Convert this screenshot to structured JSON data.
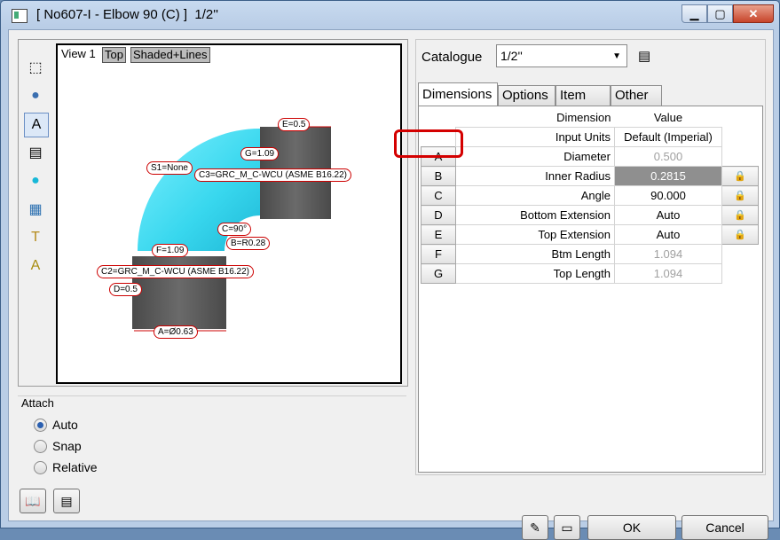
{
  "window": {
    "title": "[ No607-I - Elbow 90 (C) ]  1/2''"
  },
  "viewport": {
    "view_label": "View 1",
    "view_buttons": [
      "Top",
      "Shaded+Lines"
    ],
    "dimension_labels": {
      "e": "E=0.5",
      "g": "G=1.09",
      "s1": "S1=None",
      "c3": "C3=GRC_M_C-WCU (ASME B16.22)",
      "c": "C=90°",
      "b": "B=R0.28",
      "f": "F=1.09",
      "c2": "C2=GRC_M_C-WCU (ASME B16.22)",
      "d": "D=0.5",
      "a": "A=Ø0.63"
    }
  },
  "attach": {
    "title": "Attach",
    "options": [
      {
        "label": "Auto",
        "selected": true
      },
      {
        "label": "Snap",
        "selected": false
      },
      {
        "label": "Relative",
        "selected": false
      }
    ]
  },
  "catalogue": {
    "label": "Catalogue",
    "value": "1/2''"
  },
  "tabs": [
    "Dimensions",
    "Options",
    "Item",
    "Other"
  ],
  "table": {
    "headers": {
      "dimension": "Dimension",
      "value": "Value"
    },
    "units": {
      "label": "Input Units",
      "value": "Default (Imperial)"
    },
    "rows": [
      {
        "key": "A",
        "name": "Diameter",
        "value": "0.500",
        "state": "grey",
        "lock": false
      },
      {
        "key": "B",
        "name": "Inner Radius",
        "value": "0.2815",
        "state": "dark",
        "lock": true
      },
      {
        "key": "C",
        "name": "Angle",
        "value": "90.000",
        "state": "normal",
        "lock": true
      },
      {
        "key": "D",
        "name": "Bottom Extension",
        "value": "Auto",
        "state": "normal",
        "lock": true
      },
      {
        "key": "E",
        "name": "Top Extension",
        "value": "Auto",
        "state": "normal",
        "lock": true
      },
      {
        "key": "F",
        "name": "Btm Length",
        "value": "1.094",
        "state": "grey",
        "lock": false
      },
      {
        "key": "G",
        "name": "Top Length",
        "value": "1.094",
        "state": "grey",
        "lock": false
      }
    ]
  },
  "buttons": {
    "ok": "OK",
    "cancel": "Cancel"
  },
  "colors": {
    "elbow": "#38d7ee",
    "pipe": "#555555",
    "highlight": "#d40000"
  }
}
